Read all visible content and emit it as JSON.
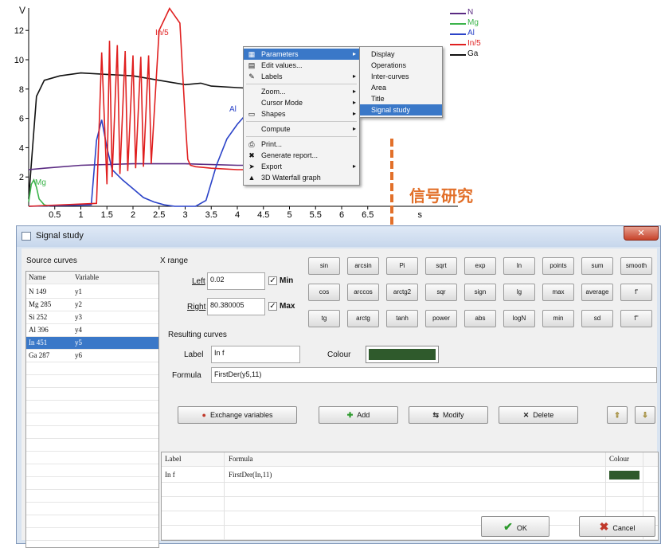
{
  "chart": {
    "y_axis_label": "V",
    "x_axis_label": "s",
    "colors": {
      "N": "#5a2a82",
      "Mg": "#3cb44b",
      "Al": "#2b43c8",
      "In5": "#e02020",
      "Ga": "#111111"
    },
    "legend": [
      {
        "label": "N",
        "color": "#5a2a82"
      },
      {
        "label": "Mg",
        "color": "#3cb44b"
      },
      {
        "label": "Al",
        "color": "#2b43c8"
      },
      {
        "label": "In/5",
        "color": "#e02020"
      },
      {
        "label": "Ga",
        "color": "#111111"
      }
    ],
    "curve_labels": {
      "in": "In/5",
      "al": "Al",
      "mg": "Mg"
    }
  },
  "chart_data": {
    "type": "line",
    "xlim": [
      0,
      8
    ],
    "ylim": [
      0,
      13
    ],
    "xticks": [
      "0.5",
      "1",
      "1.5",
      "2",
      "2.5",
      "3",
      "3.5",
      "4",
      "4.5",
      "5",
      "5.5",
      "6",
      "6.5",
      "s"
    ],
    "yticks": [
      "2",
      "4",
      "6",
      "8",
      "10",
      "12"
    ],
    "series": [
      {
        "name": "Ga",
        "x": [
          0,
          0.15,
          0.3,
          0.6,
          1.0,
          1.5,
          2.0,
          2.5,
          3.0,
          3.3,
          3.5,
          4.0,
          4.5
        ],
        "y": [
          0.5,
          7.5,
          8.6,
          8.9,
          9.1,
          9.0,
          8.9,
          8.6,
          8.3,
          8.4,
          8.2,
          8.1,
          8.0
        ]
      },
      {
        "name": "N",
        "x": [
          0,
          0.3,
          1.0,
          2.0,
          3.0,
          3.5,
          4.0,
          4.5
        ],
        "y": [
          2.5,
          2.6,
          2.8,
          2.9,
          2.9,
          2.85,
          2.8,
          2.8
        ]
      },
      {
        "name": "Mg",
        "x": [
          0,
          0.05,
          0.1,
          0.15,
          0.2,
          0.3,
          0.4
        ],
        "y": [
          0.3,
          1.5,
          1.8,
          1.3,
          0.5,
          0.1,
          0
        ]
      },
      {
        "name": "Al",
        "x": [
          0,
          1.2,
          1.3,
          1.4,
          1.5,
          1.6,
          1.8,
          2.0,
          2.2,
          2.4,
          2.6,
          2.8,
          3.0,
          3.2,
          3.4,
          3.6,
          3.8,
          4.0,
          4.3
        ],
        "y": [
          0,
          0.1,
          4.5,
          5.9,
          4.0,
          2.5,
          1.8,
          1.2,
          0.6,
          0.3,
          0.1,
          0,
          0,
          0,
          0.4,
          2.8,
          4.6,
          5.6,
          6.8
        ]
      },
      {
        "name": "In/5",
        "x": [
          0,
          1.3,
          1.4,
          1.5,
          1.55,
          1.6,
          1.7,
          1.75,
          1.85,
          1.9,
          2.0,
          2.05,
          2.15,
          2.2,
          2.3,
          2.35,
          2.5,
          2.7,
          2.9,
          3.0,
          3.05,
          3.1,
          3.2,
          3.5,
          4.0,
          4.5
        ],
        "y": [
          0,
          0.2,
          10.5,
          1.5,
          11.3,
          2.0,
          11.0,
          2.2,
          10.6,
          2.4,
          10.3,
          2.6,
          10.2,
          2.7,
          10.3,
          2.9,
          12.0,
          13.5,
          12.5,
          6.0,
          3.2,
          2.8,
          2.7,
          2.6,
          2.5,
          2.5
        ]
      }
    ]
  },
  "context_menu": {
    "items": [
      {
        "label": "Parameters",
        "icon": "parameters-icon",
        "icon_glyph": "▦",
        "submenu": true,
        "selected": true
      },
      {
        "label": "Edit values...",
        "icon": "edit-values-icon",
        "icon_glyph": "▤"
      },
      {
        "label": "Labels",
        "icon": "labels-icon",
        "icon_glyph": "✎",
        "submenu": true
      },
      {
        "label": "Zoom...",
        "submenu": true,
        "sep_before": true
      },
      {
        "label": "Cursor Mode",
        "submenu": true
      },
      {
        "label": "Shapes",
        "icon": "shapes-icon",
        "icon_glyph": "▭",
        "submenu": true
      },
      {
        "label": "Compute",
        "submenu": true,
        "sep_before": true
      },
      {
        "label": "Print...",
        "icon": "print-icon",
        "icon_glyph": "⎙",
        "sep_before": true
      },
      {
        "label": "Generate report...",
        "icon": "report-icon",
        "icon_glyph": "✖"
      },
      {
        "label": "Export",
        "icon": "export-icon",
        "icon_glyph": "➤",
        "submenu": true
      },
      {
        "label": "3D Waterfall graph",
        "icon": "waterfall-icon",
        "icon_glyph": "▲"
      }
    ],
    "submenu": [
      "Display",
      "Operations",
      "Inter-curves",
      "Area",
      "Title",
      "Signal study"
    ]
  },
  "annotation": {
    "text": "信号研究",
    "color": "#e2702a"
  },
  "dialog": {
    "title": "Signal study",
    "close_glyph": "✕",
    "source_curves_label": "Source curves",
    "source_columns": [
      "Name",
      "Variable"
    ],
    "source_rows": [
      {
        "name": "N 149",
        "var": "y1"
      },
      {
        "name": "Mg 285",
        "var": "y2"
      },
      {
        "name": "Si 252",
        "var": "y3"
      },
      {
        "name": "Al 396",
        "var": "y4"
      },
      {
        "name": "In 451",
        "var": "y5",
        "selected": true
      },
      {
        "name": "Ga 287",
        "var": "y6"
      }
    ],
    "x_range_label": "X range",
    "left_label": "Left",
    "left_value": "0.02",
    "min_label": "Min",
    "right_label": "Right",
    "right_value": "80.380005",
    "max_label": "Max",
    "check_glyph": "✓",
    "functions": [
      [
        "sin",
        "arcsin",
        "Pi",
        "sqrt",
        "exp",
        "ln",
        "points",
        "sum",
        "smooth"
      ],
      [
        "cos",
        "arccos",
        "arctg2",
        "sqr",
        "sign",
        "lg",
        "max",
        "average",
        "f'"
      ],
      [
        "tg",
        "arctg",
        "tanh",
        "power",
        "abs",
        "logN",
        "min",
        "sd",
        "f''"
      ]
    ],
    "resulting_curves_label": "Resulting curves",
    "label_label": "Label",
    "label_value": "In f",
    "colour_label": "Colour",
    "colour_value": "#2f5a2c",
    "formula_label": "Formula",
    "formula_value": "FirstDer(y5,11)",
    "buttons": {
      "exchange": "Exchange variables",
      "add": "Add",
      "modify": "Modify",
      "delete": "Delete",
      "ok": "OK",
      "cancel": "Cancel"
    },
    "result_columns": [
      "Label",
      "Formula",
      "Colour"
    ],
    "result_rows": [
      {
        "label": "In f",
        "formula": "FirstDer(In,11)",
        "colour": "#2f5a2c"
      }
    ]
  }
}
